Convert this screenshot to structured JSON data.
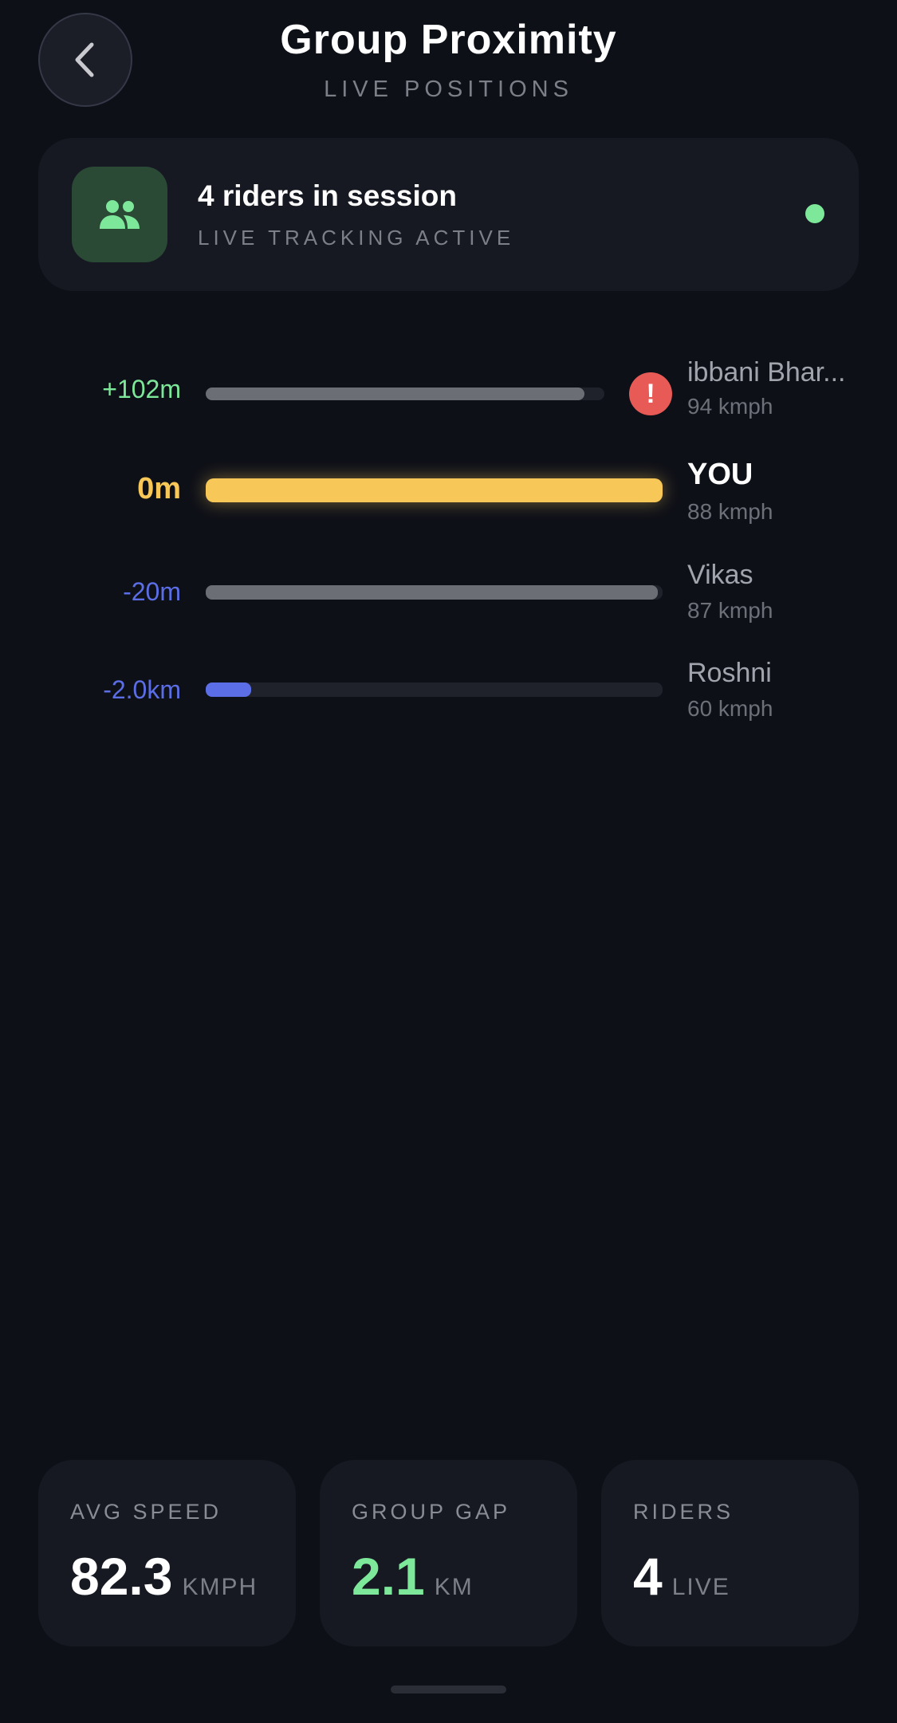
{
  "header": {
    "title": "Group Proximity",
    "subtitle": "LIVE POSITIONS"
  },
  "session": {
    "title": "4 riders in session",
    "status": "LIVE TRACKING ACTIVE",
    "icon": "group-icon",
    "status_color": "#7ee89a"
  },
  "riders": [
    {
      "offset": "+102m",
      "name": "ibbani Bhar...",
      "speed": "94 kmph",
      "progress": 0.95,
      "alert": true,
      "alert_symbol": "!",
      "color": "#6c6e76",
      "offset_color": "#7ee89a"
    },
    {
      "offset": "0m",
      "name": "YOU",
      "speed": "88 kmph",
      "progress": 1.0,
      "alert": false,
      "color": "#f7c858",
      "offset_color": "#f7c858"
    },
    {
      "offset": "-20m",
      "name": "Vikas",
      "speed": "87 kmph",
      "progress": 0.99,
      "alert": false,
      "color": "#6c6e76",
      "offset_color": "#5b6ee6"
    },
    {
      "offset": "-2.0km",
      "name": "Roshni",
      "speed": "60 kmph",
      "progress": 0.1,
      "alert": false,
      "color": "#5b6ee6",
      "offset_color": "#5b6ee6"
    }
  ],
  "stats": {
    "avg_speed": {
      "label": "AVG SPEED",
      "value": "82.3",
      "unit": "KMPH"
    },
    "group_gap": {
      "label": "GROUP GAP",
      "value": "2.1",
      "unit": "KM",
      "color": "#7ee89a"
    },
    "riders": {
      "label": "RIDERS",
      "value": "4",
      "unit": "LIVE"
    }
  },
  "colors": {
    "background": "#0e1018",
    "card": "#171922",
    "accent_you": "#f7c858",
    "behind": "#5b6ee6",
    "ahead": "#7ee89a",
    "alert": "#e85a55"
  }
}
